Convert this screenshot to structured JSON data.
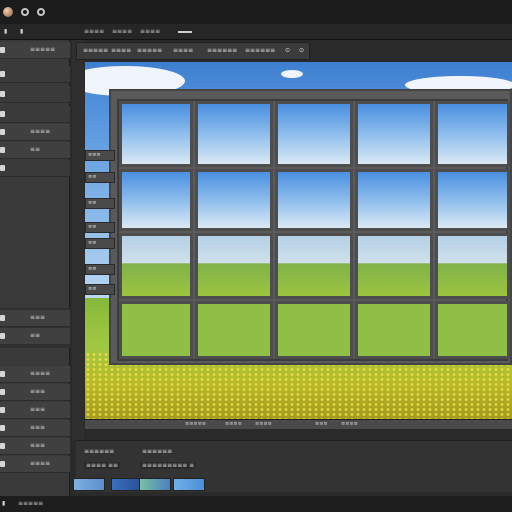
{
  "titlebar": {
    "icons": [
      "app-logo-icon",
      "settings-icon",
      "help-icon"
    ]
  },
  "toolbar": {
    "items": [
      "≡≡≡≡",
      "≡≡≡≡",
      "≡≡≡≡"
    ]
  },
  "tabs": [
    "≡≡≡≡≡",
    "≡≡≡≡",
    "≡≡≡≡≡",
    "≡≡≡≡",
    "≡≡≡≡≡≡",
    "≡≡≡≡≡≡"
  ],
  "left_panel": {
    "rows": [
      {
        "icon": "layer-icon",
        "label": "≡≡≡≡≡"
      },
      {
        "icon": "eye-icon",
        "label": ""
      },
      {
        "icon": "brush-icon",
        "label": ""
      },
      {
        "icon": "folder-icon",
        "label": ""
      },
      {
        "icon": "layer-icon",
        "label": "≡≡≡≡"
      },
      {
        "icon": "eye-icon",
        "label": "≡≡"
      },
      {
        "icon": "layer-icon",
        "label": ""
      },
      {
        "icon": "layer-icon",
        "label": "≡≡≡"
      },
      {
        "icon": "layer-icon",
        "label": "≡≡"
      },
      {
        "icon": "layer-icon",
        "label": "≡≡≡≡"
      },
      {
        "icon": "layer-icon",
        "label": "≡≡≡"
      },
      {
        "icon": "layer-icon",
        "label": "≡≡≡"
      },
      {
        "icon": "layer-icon",
        "label": "≡≡≡"
      },
      {
        "icon": "layer-icon",
        "label": "≡≡≡"
      },
      {
        "icon": "layer-icon",
        "label": "≡≡≡≡"
      }
    ]
  },
  "side_buttons": [
    "≡≡≡",
    "≡≡",
    "≡≡",
    "≡≡",
    "≡≡",
    "≡≡",
    "≡≡"
  ],
  "statusbar": {
    "items": [
      "≡≡≡≡≡",
      "≡≡≡≡",
      "≡≡≡≡",
      "≡≡≡",
      "≡≡≡≡"
    ]
  },
  "bottom_panel": {
    "row1": [
      "≡≡≡≡≡≡",
      "≡≡≡≡≡≡"
    ],
    "row2": [
      "≡≡≡≡ ≡≡",
      "≡≡≡≡≡≡≡≡≡ ≡"
    ],
    "thumbnails": 4
  },
  "footer": {
    "items": [
      "≡≡≡≡≡"
    ]
  },
  "colors": {
    "bg": "#2a2a2a",
    "panel": "#3a3a3a",
    "sky": "#5a98df",
    "grass": "#a1c842",
    "frame": "#4d4d4d"
  }
}
